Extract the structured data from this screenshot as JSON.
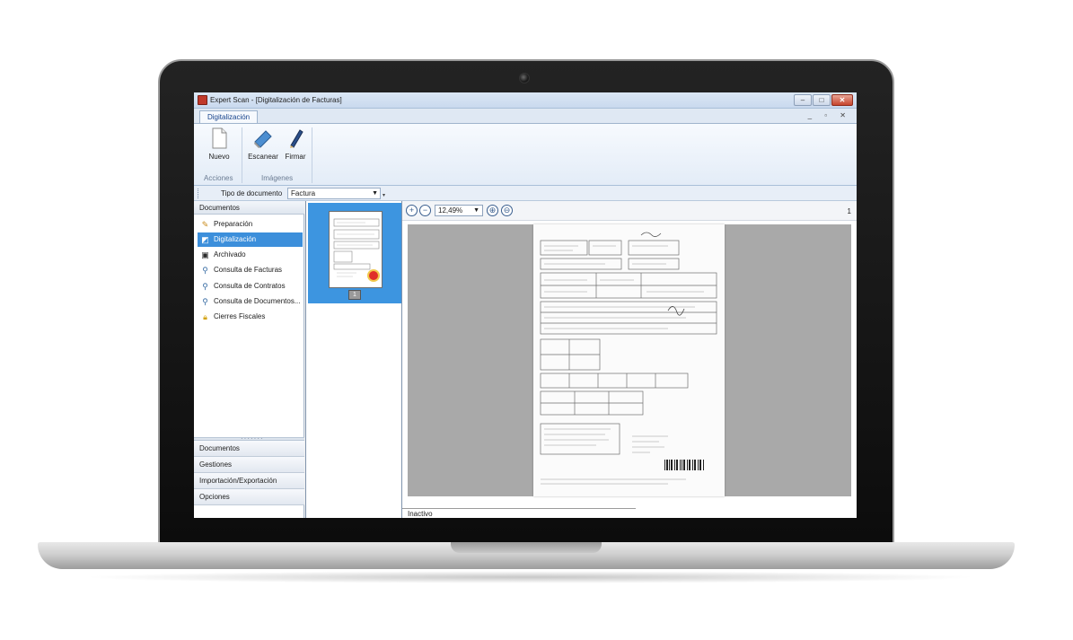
{
  "window": {
    "title": "Expert Scan - [Digitalización de Facturas]",
    "minimize_glyph": "–",
    "maximize_glyph": "□",
    "close_glyph": "✕",
    "mdi_controls": "_ ▫ ✕"
  },
  "ribbon": {
    "tab": "Digitalización",
    "groups": [
      {
        "label": "Acciones",
        "buttons": [
          {
            "label": "Nuevo",
            "icon": "new-document-icon"
          }
        ]
      },
      {
        "label": "Imágenes",
        "buttons": [
          {
            "label": "Escanear",
            "icon": "scanner-icon"
          },
          {
            "label": "Firmar",
            "icon": "pen-icon"
          }
        ]
      }
    ]
  },
  "toolbar": {
    "doc_type_label": "Tipo de documento",
    "doc_type_value": "Factura"
  },
  "nav": {
    "header": "Documentos",
    "items": [
      {
        "label": "Preparación",
        "icon": "edit-document-icon",
        "active": false
      },
      {
        "label": "Digitalización",
        "icon": "scan-icon",
        "active": true
      },
      {
        "label": "Archivado",
        "icon": "save-icon",
        "active": false
      },
      {
        "label": "Consulta de Facturas",
        "icon": "search-icon",
        "active": false
      },
      {
        "label": "Consulta de Contratos",
        "icon": "search-icon",
        "active": false
      },
      {
        "label": "Consulta de Documentos...",
        "icon": "search-icon",
        "active": false
      },
      {
        "label": "Cierres Fiscales",
        "icon": "lock-icon",
        "active": false
      }
    ],
    "sections": [
      "Documentos",
      "Gestiones",
      "Importación/Exportación",
      "Opciones"
    ]
  },
  "thumbnails": {
    "page_number": "1"
  },
  "viewer": {
    "zoom": "12,49%",
    "page_count": "1",
    "status": "Inactivo"
  },
  "colors": {
    "selection": "#3c8fdb",
    "ribbon_text": "#15428b",
    "canvas_gray": "#a9a9a9"
  }
}
